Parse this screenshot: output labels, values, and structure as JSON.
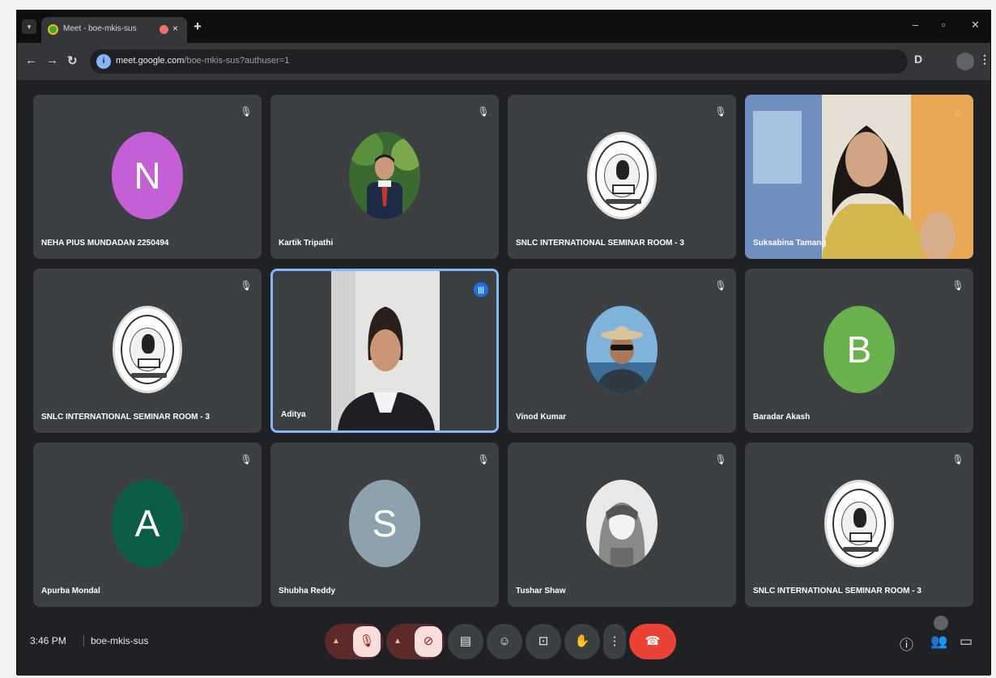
{
  "browser": {
    "tab_title": "Meet - boe-mkis-sus",
    "url_host": "meet.google.com",
    "url_path": "/boe-mkis-sus?authuser=1",
    "new_tab_label": "+",
    "close_tab_label": "×"
  },
  "meet": {
    "participants": [
      {
        "name": "NEHA PIUS MUNDADAN 2250494",
        "type": "initial",
        "initial": "N",
        "color": "#c55fd6",
        "mic": "off"
      },
      {
        "name": "Kartik Tripathi",
        "type": "photo",
        "mic": "off"
      },
      {
        "name": "SNLC INTERNATIONAL SEMINAR ROOM - 3",
        "type": "seal",
        "mic": "off"
      },
      {
        "name": "Suksabina Tamang",
        "type": "video",
        "mic": "on"
      },
      {
        "name": "SNLC INTERNATIONAL SEMINAR ROOM - 3",
        "type": "seal",
        "mic": "off"
      },
      {
        "name": "Aditya",
        "type": "video",
        "mic": "speaking"
      },
      {
        "name": "Vinod Kumar",
        "type": "photo",
        "mic": "off"
      },
      {
        "name": "Baradar Akash",
        "type": "initial",
        "initial": "B",
        "color": "#6ab04c",
        "mic": "off"
      },
      {
        "name": "Apurba Mondal",
        "type": "initial",
        "initial": "A",
        "color": "#0b5d45",
        "mic": "off"
      },
      {
        "name": "Shubha Reddy",
        "type": "initial",
        "initial": "S",
        "color": "#8ea2ad",
        "mic": "off"
      },
      {
        "name": "Tushar Shaw",
        "type": "photo",
        "mic": "off"
      },
      {
        "name": "SNLC INTERNATIONAL SEMINAR ROOM - 3",
        "type": "seal",
        "mic": "off"
      }
    ],
    "time": "3:46 PM",
    "meeting_code": "boe-mkis-sus"
  }
}
